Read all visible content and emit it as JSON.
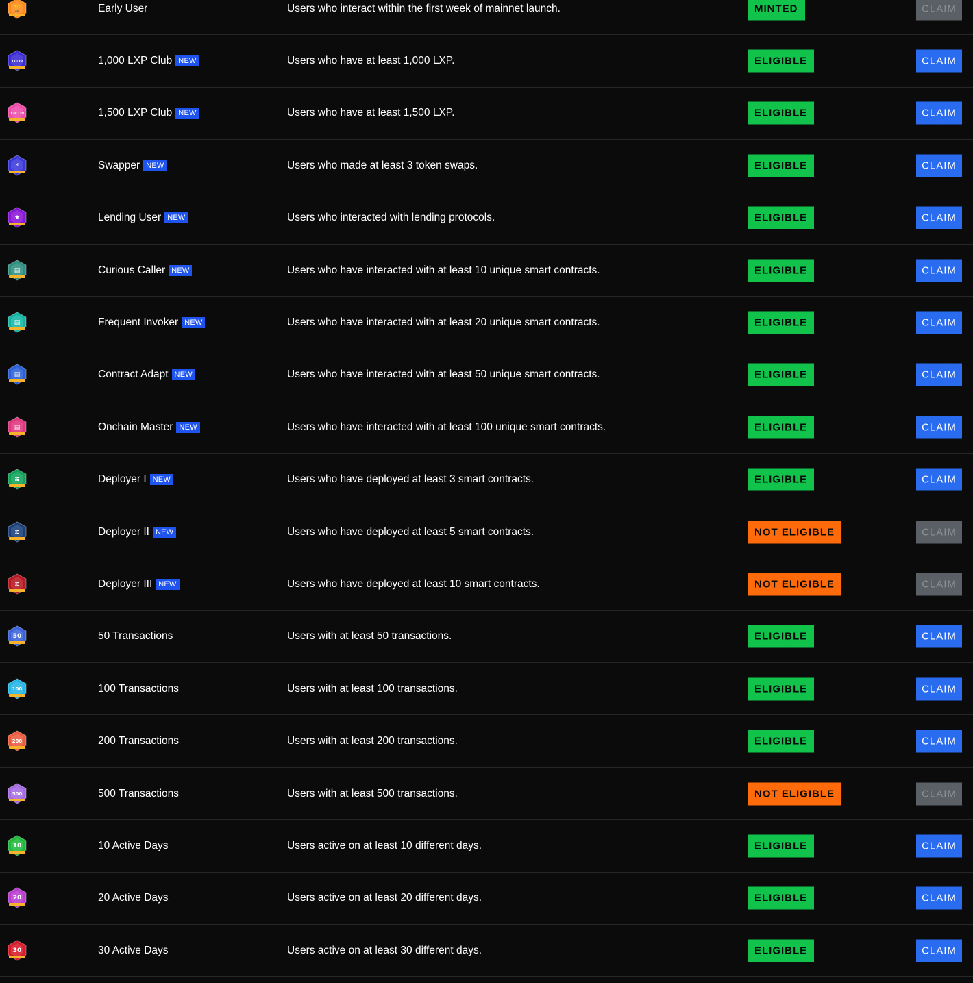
{
  "new_label": "NEW",
  "rows": [
    {
      "name": "Early User",
      "is_new": false,
      "description": "Users who interact within the first week of mainnet launch.",
      "status": "MINTED",
      "status_type": "minted",
      "claim_label": "CLAIM",
      "claim_enabled": false,
      "icon": "trophy-badge-icon",
      "color": "#ff8a1c",
      "glyph": "🏆"
    },
    {
      "name": "1,000 LXP Club",
      "is_new": true,
      "description": "Users who have at least 1,000 LXP.",
      "status": "ELIGIBLE",
      "status_type": "eligible",
      "claim_label": "CLAIM",
      "claim_enabled": true,
      "icon": "lxp-1000-badge-icon",
      "color": "#3b2bd6",
      "glyph": "1K LXP"
    },
    {
      "name": "1,500 LXP Club",
      "is_new": true,
      "description": "Users who have at least 1,500 LXP.",
      "status": "ELIGIBLE",
      "status_type": "eligible",
      "claim_label": "CLAIM",
      "claim_enabled": true,
      "icon": "lxp-1500-badge-icon",
      "color": "#ec4ba8",
      "glyph": "1.5K LXP"
    },
    {
      "name": "Swapper",
      "is_new": true,
      "description": "Users who made at least 3 token swaps.",
      "status": "ELIGIBLE",
      "status_type": "eligible",
      "claim_label": "CLAIM",
      "claim_enabled": true,
      "icon": "swap-badge-icon",
      "color": "#3a37d9",
      "glyph": "⚡"
    },
    {
      "name": "Lending User",
      "is_new": true,
      "description": "Users who interacted with lending protocols.",
      "status": "ELIGIBLE",
      "status_type": "eligible",
      "claim_label": "CLAIM",
      "claim_enabled": true,
      "icon": "lending-badge-icon",
      "color": "#8a15d8",
      "glyph": "★"
    },
    {
      "name": "Curious Caller",
      "is_new": true,
      "description": "Users who have interacted with at least 10 unique smart contracts.",
      "status": "ELIGIBLE",
      "status_type": "eligible",
      "claim_label": "CLAIM",
      "claim_enabled": true,
      "icon": "contract-10-badge-icon",
      "color": "#2d8f80",
      "glyph": "▤"
    },
    {
      "name": "Frequent Invoker",
      "is_new": true,
      "description": "Users who have interacted with at least 20 unique smart contracts.",
      "status": "ELIGIBLE",
      "status_type": "eligible",
      "claim_label": "CLAIM",
      "claim_enabled": true,
      "icon": "contract-20-badge-icon",
      "color": "#15b5a5",
      "glyph": "▤"
    },
    {
      "name": "Contract Adapt",
      "is_new": true,
      "description": "Users who have interacted with at least 50 unique smart contracts.",
      "status": "ELIGIBLE",
      "status_type": "eligible",
      "claim_label": "CLAIM",
      "claim_enabled": true,
      "icon": "contract-50-badge-icon",
      "color": "#2a5fd6",
      "glyph": "▤"
    },
    {
      "name": "Onchain Master",
      "is_new": true,
      "description": "Users who have interacted with at least 100 unique smart contracts.",
      "status": "ELIGIBLE",
      "status_type": "eligible",
      "claim_label": "CLAIM",
      "claim_enabled": true,
      "icon": "contract-100-badge-icon",
      "color": "#e0357f",
      "glyph": "▤"
    },
    {
      "name": "Deployer I",
      "is_new": true,
      "description": "Users who have deployed at least 3 smart contracts.",
      "status": "ELIGIBLE",
      "status_type": "eligible",
      "claim_label": "CLAIM",
      "claim_enabled": true,
      "icon": "deployer-1-badge-icon",
      "color": "#11a25a",
      "glyph": "≋"
    },
    {
      "name": "Deployer II",
      "is_new": true,
      "description": "Users who have deployed at least 5 smart contracts.",
      "status": "NOT ELIGIBLE",
      "status_type": "not-eligible",
      "claim_label": "CLAIM",
      "claim_enabled": false,
      "icon": "deployer-2-badge-icon",
      "color": "#1a3f7a",
      "glyph": "≋"
    },
    {
      "name": "Deployer III",
      "is_new": true,
      "description": "Users who have deployed at least 10 smart contracts.",
      "status": "NOT ELIGIBLE",
      "status_type": "not-eligible",
      "claim_label": "CLAIM",
      "claim_enabled": false,
      "icon": "deployer-3-badge-icon",
      "color": "#b51822",
      "glyph": "≋"
    },
    {
      "name": "50 Transactions",
      "is_new": false,
      "description": "Users with at least 50 transactions.",
      "status": "ELIGIBLE",
      "status_type": "eligible",
      "claim_label": "CLAIM",
      "claim_enabled": true,
      "icon": "tx-50-badge-icon",
      "color": "#3b63d9",
      "glyph": "50"
    },
    {
      "name": "100 Transactions",
      "is_new": false,
      "description": "Users with at least 100 transactions.",
      "status": "ELIGIBLE",
      "status_type": "eligible",
      "claim_label": "CLAIM",
      "claim_enabled": true,
      "icon": "tx-100-badge-icon",
      "color": "#24b6e6",
      "glyph": "100"
    },
    {
      "name": "200 Transactions",
      "is_new": false,
      "description": "Users with at least 200 transactions.",
      "status": "ELIGIBLE",
      "status_type": "eligible",
      "claim_label": "CLAIM",
      "claim_enabled": true,
      "icon": "tx-200-badge-icon",
      "color": "#ea5a3c",
      "glyph": "200"
    },
    {
      "name": "500 Transactions",
      "is_new": false,
      "description": "Users with at least 500 transactions.",
      "status": "NOT ELIGIBLE",
      "status_type": "not-eligible",
      "claim_label": "CLAIM",
      "claim_enabled": false,
      "icon": "tx-500-badge-icon",
      "color": "#a46ae0",
      "glyph": "500"
    },
    {
      "name": "10 Active Days",
      "is_new": false,
      "description": "Users active on at least 10 different days.",
      "status": "ELIGIBLE",
      "status_type": "eligible",
      "claim_label": "CLAIM",
      "claim_enabled": true,
      "icon": "active-10-badge-icon",
      "color": "#1fb93d",
      "glyph": "10"
    },
    {
      "name": "20 Active Days",
      "is_new": false,
      "description": "Users active on at least 20 different days.",
      "status": "ELIGIBLE",
      "status_type": "eligible",
      "claim_label": "CLAIM",
      "claim_enabled": true,
      "icon": "active-20-badge-icon",
      "color": "#b93cd0",
      "glyph": "20"
    },
    {
      "name": "30 Active Days",
      "is_new": false,
      "description": "Users active on at least 30 different days.",
      "status": "ELIGIBLE",
      "status_type": "eligible",
      "claim_label": "CLAIM",
      "claim_enabled": true,
      "icon": "active-30-badge-icon",
      "color": "#d61a2a",
      "glyph": "30"
    }
  ]
}
